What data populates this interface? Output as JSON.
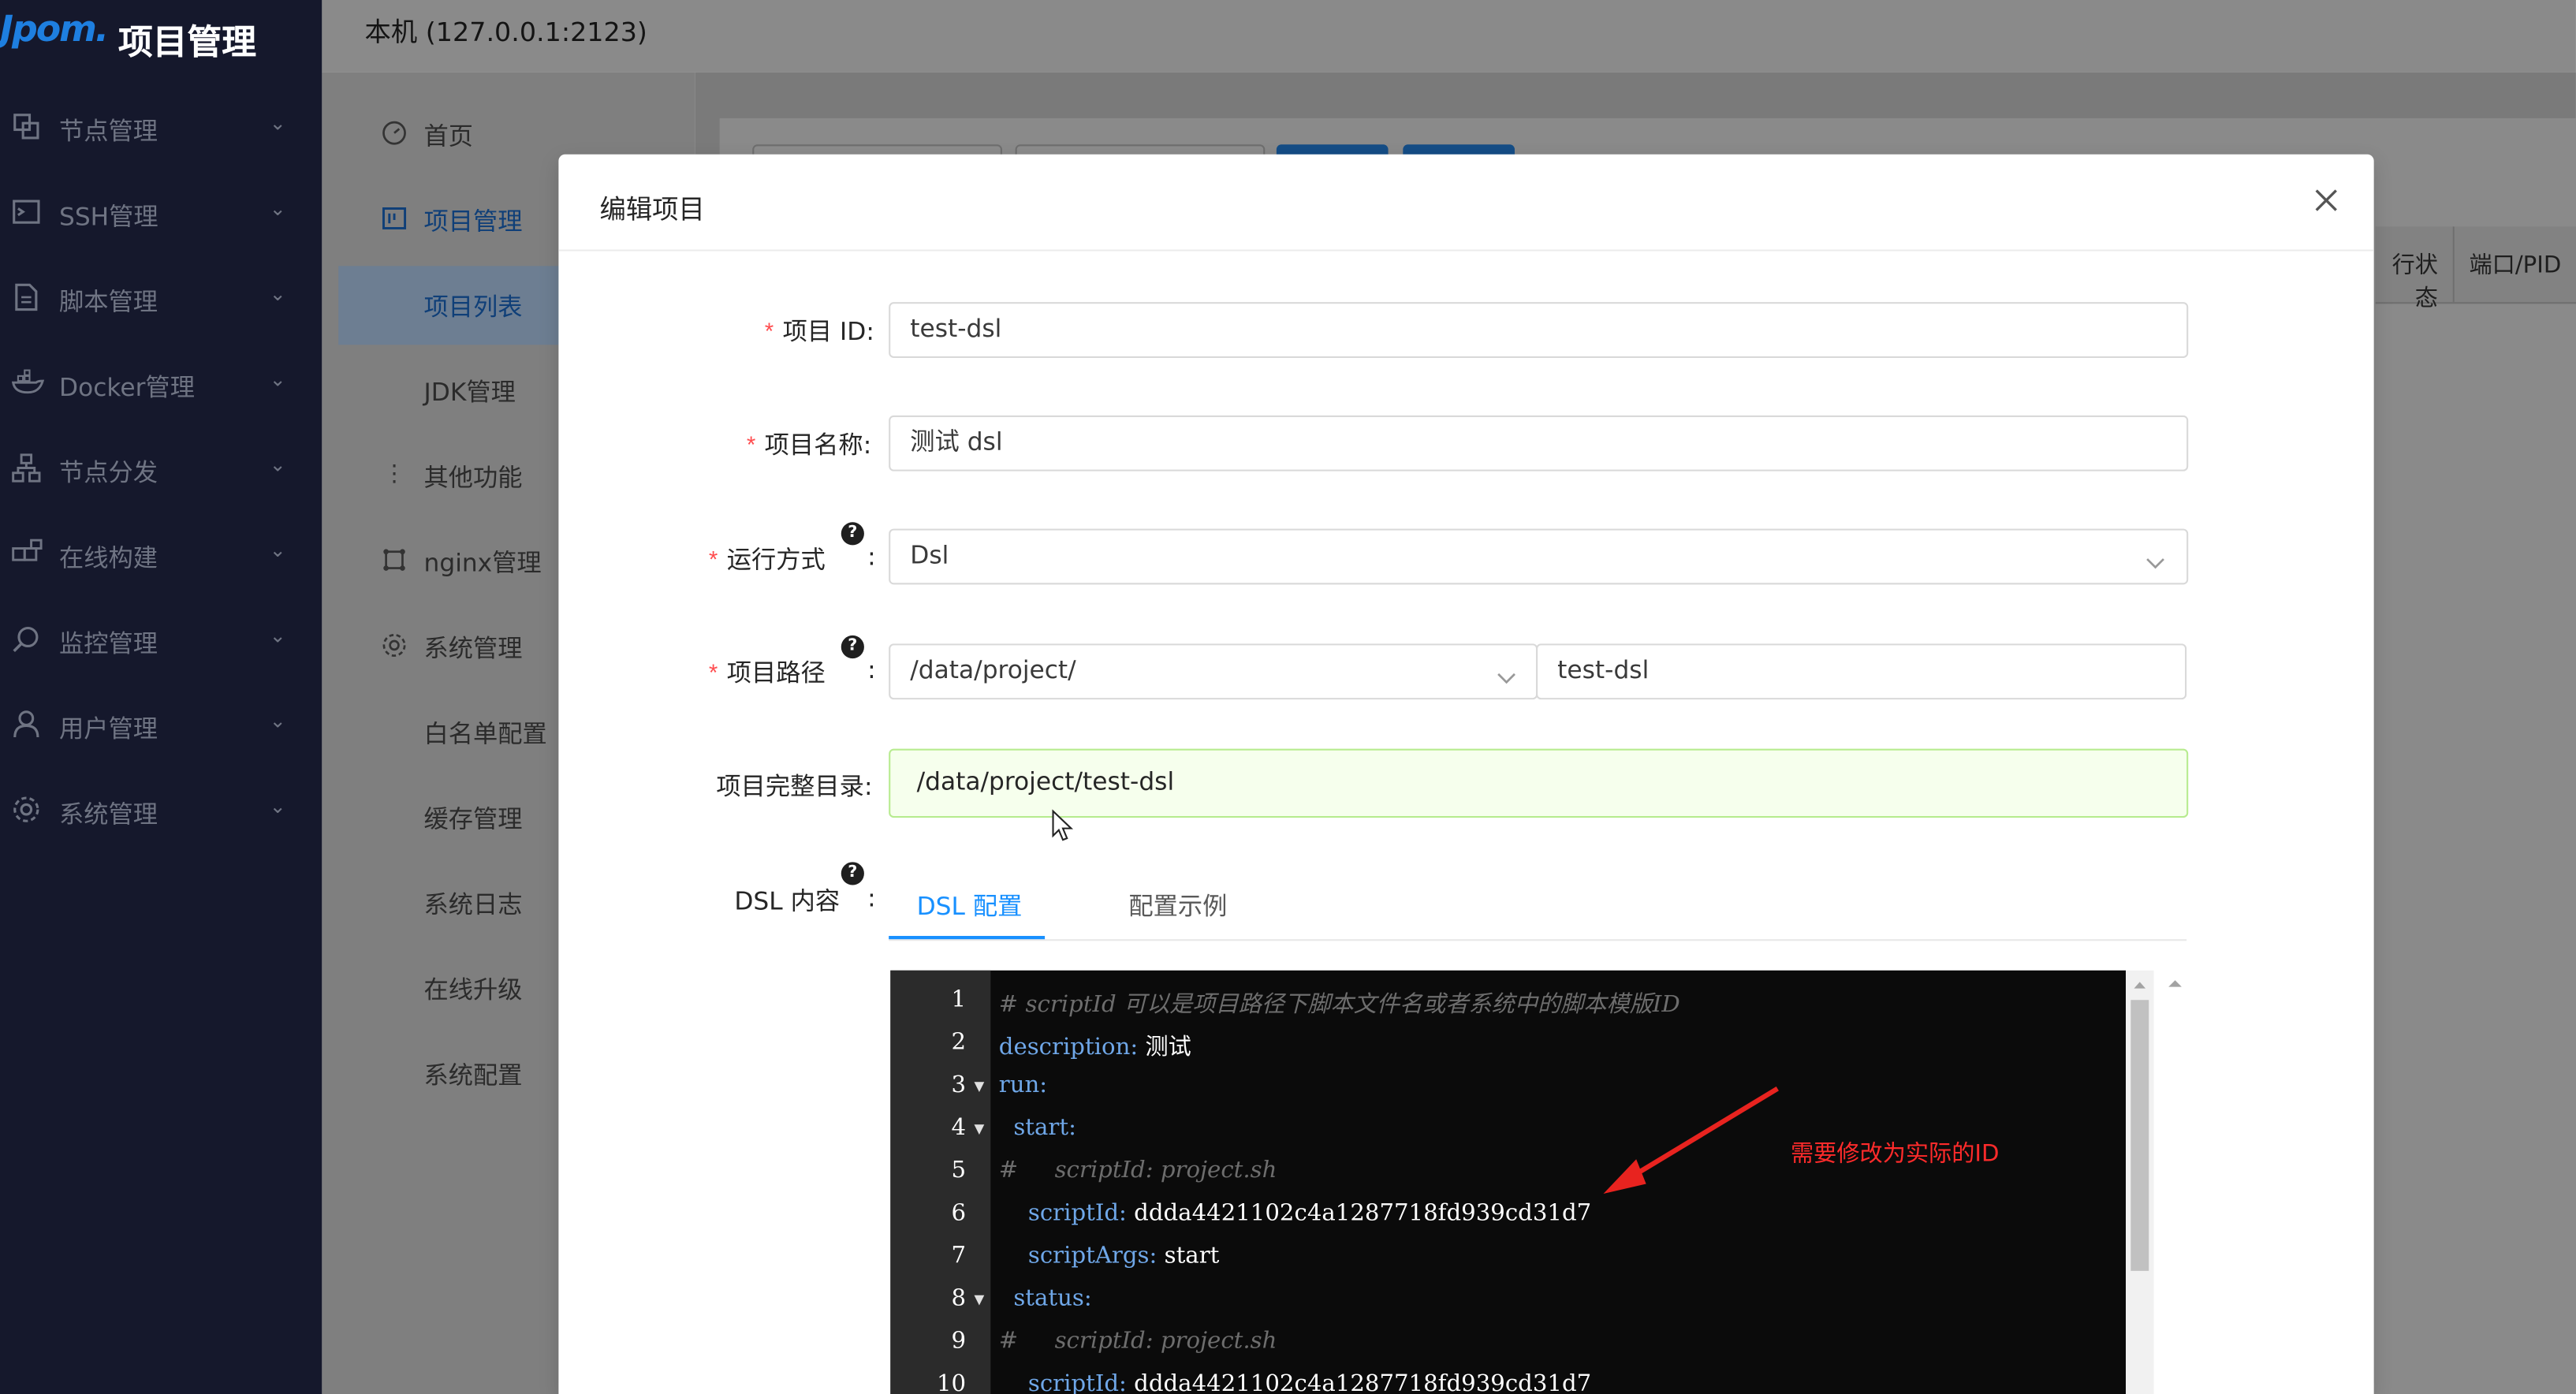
{
  "app": {
    "logo_text": "Jpom.",
    "title": "项目管理"
  },
  "header": {
    "node_title": "本机 (127.0.0.1:2123)"
  },
  "sidebar": {
    "items": [
      {
        "label": "节点管理",
        "icon": "node-icon"
      },
      {
        "label": "SSH管理",
        "icon": "terminal-icon"
      },
      {
        "label": "脚本管理",
        "icon": "file-icon"
      },
      {
        "label": "Docker管理",
        "icon": "docker-icon"
      },
      {
        "label": "节点分发",
        "icon": "apartment-icon"
      },
      {
        "label": "在线构建",
        "icon": "build-icon"
      },
      {
        "label": "监控管理",
        "icon": "monitor-icon"
      },
      {
        "label": "用户管理",
        "icon": "user-icon"
      },
      {
        "label": "系统管理",
        "icon": "gear-icon"
      }
    ]
  },
  "submenu": {
    "items": [
      {
        "label": "首页",
        "icon": "dashboard-icon"
      },
      {
        "label": "项目管理",
        "icon": "project-icon"
      },
      {
        "label": "项目列表"
      },
      {
        "label": "JDK管理"
      },
      {
        "label": "其他功能",
        "icon": "more-icon"
      },
      {
        "label": "nginx管理",
        "icon": "nginx-icon"
      },
      {
        "label": "系统管理",
        "icon": "gear-icon"
      },
      {
        "label": "白名单配置"
      },
      {
        "label": "缓存管理"
      },
      {
        "label": "系统日志"
      },
      {
        "label": "在线升级"
      },
      {
        "label": "系统配置"
      }
    ]
  },
  "table": {
    "columns": [
      "行状态",
      "端口/PID"
    ]
  },
  "modal": {
    "title": "编辑项目",
    "fields": {
      "project_id": {
        "label": "项目 ID",
        "value": "test-dsl",
        "required": true
      },
      "project_name": {
        "label": "项目名称",
        "value": "测试 dsl",
        "required": true
      },
      "run_mode": {
        "label": "运行方式",
        "value": "Dsl",
        "required": true
      },
      "project_path": {
        "label": "项目路径",
        "root": "/data/project/",
        "dir": "test-dsl",
        "required": true
      },
      "full_dir": {
        "label": "项目完整目录",
        "value": "/data/project/test-dsl"
      },
      "dsl_content": {
        "label": "DSL 内容"
      }
    },
    "tabs": [
      {
        "label": "DSL 配置",
        "active": true
      },
      {
        "label": "配置示例",
        "active": false
      }
    ],
    "help_glyph": "?",
    "colon": ":",
    "required_mark": "*",
    "code_lines": [
      {
        "n": "1",
        "text": "# scriptId 可以是项目路径下脚本文件名或者系统中的脚本模版ID"
      },
      {
        "n": "2",
        "key": "description",
        "value": "测试"
      },
      {
        "n": "3",
        "key": "run",
        "value": ""
      },
      {
        "n": "4",
        "key": "start",
        "value": ""
      },
      {
        "n": "5",
        "text": "#     scriptId: project.sh"
      },
      {
        "n": "6",
        "key": "scriptId",
        "value": "ddda4421102c4a1287718fd939cd31d7"
      },
      {
        "n": "7",
        "key": "scriptArgs",
        "value": "start"
      },
      {
        "n": "8",
        "key": "status",
        "value": ""
      },
      {
        "n": "9",
        "text": "#     scriptId: project.sh"
      },
      {
        "n": "10",
        "key": "scriptId",
        "value": "ddda4421102c4a1287718fd939cd31d7"
      }
    ],
    "annotation": "需要修改为实际的ID"
  },
  "colors": {
    "sidebar_bg": "#15182c",
    "accent": "#1890ff",
    "required": "#ff4d4f",
    "annotation": "#ff2b2b",
    "success_bg": "#f6ffed"
  }
}
